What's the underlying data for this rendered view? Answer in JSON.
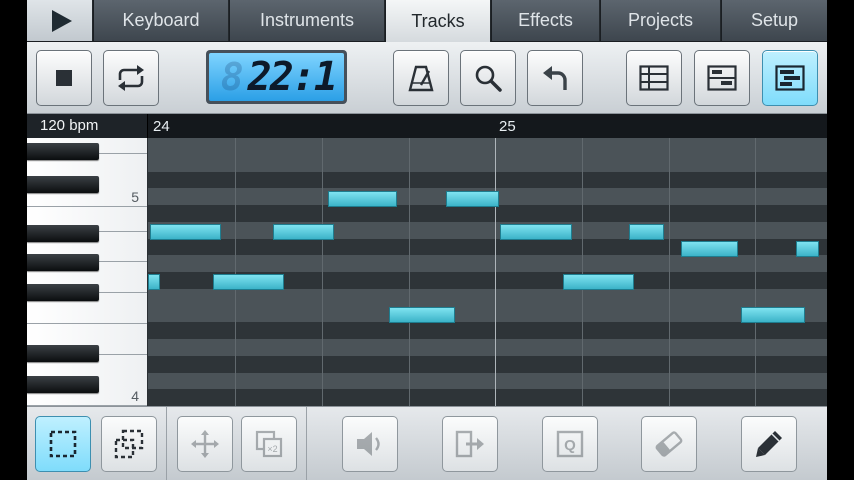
{
  "tabs": {
    "play_icon": "play-icon",
    "items": [
      {
        "label": "Keyboard",
        "active": false
      },
      {
        "label": "Instruments",
        "active": false
      },
      {
        "label": "Tracks",
        "active": true
      },
      {
        "label": "Effects",
        "active": false
      },
      {
        "label": "Projects",
        "active": false
      },
      {
        "label": "Setup",
        "active": false
      }
    ]
  },
  "toolbar": {
    "position_display": "22:1",
    "buttons": [
      "stop-icon",
      "loop-icon",
      "metronome-icon",
      "zoom-icon",
      "undo-icon",
      "list-view-icon",
      "split-view-icon",
      "piano-roll-view-icon"
    ],
    "active_view": "piano-roll-view"
  },
  "timeline": {
    "tempo": "120 bpm",
    "bars": [
      "24",
      "25"
    ]
  },
  "keyboard": {
    "octave_labels": [
      "5",
      "4"
    ]
  },
  "colors": {
    "note_fill": "#4fc3d6",
    "accent_active": "#7fdcfb",
    "grid_light_row": "#4b5358",
    "grid_dark_row": "#2e3438"
  },
  "bottombar": {
    "buttons": [
      "select-box-icon",
      "select-add-icon",
      "move-icon",
      "duplicate-icon",
      "volume-icon",
      "export-icon",
      "quantize-icon",
      "eraser-icon",
      "pencil-icon"
    ],
    "quantize_label": "Q",
    "duplicate_label": "×2"
  }
}
